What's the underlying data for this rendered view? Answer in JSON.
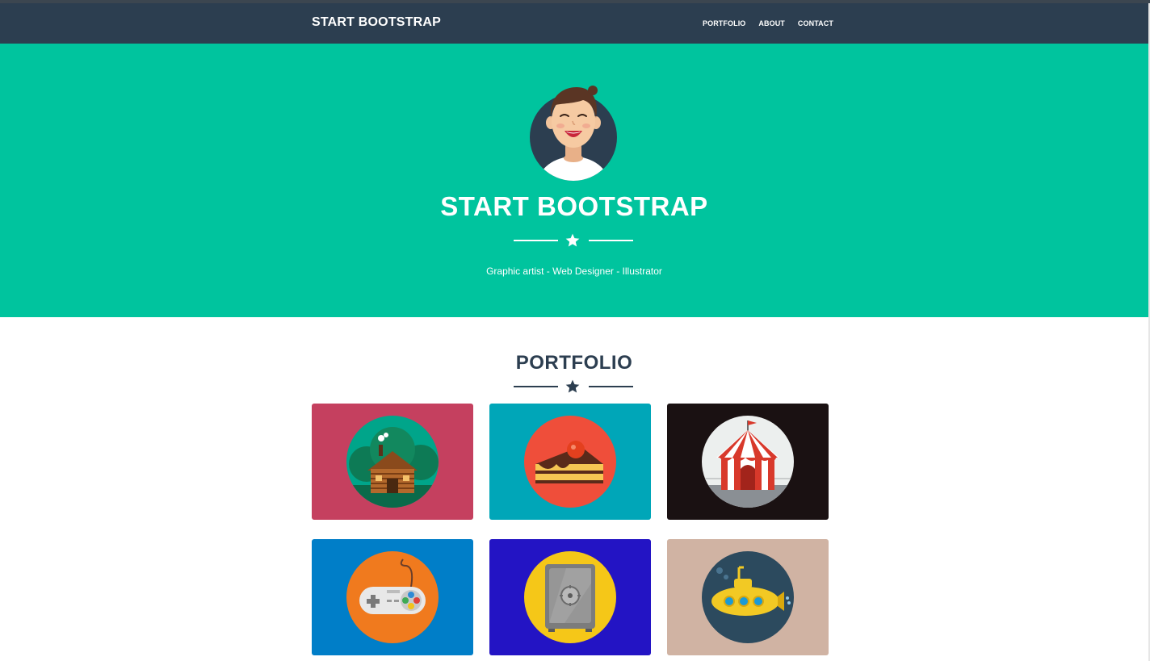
{
  "nav": {
    "brand": "START BOOTSTRAP",
    "links": [
      "PORTFOLIO",
      "ABOUT",
      "CONTACT"
    ]
  },
  "hero": {
    "title": "START BOOTSTRAP",
    "subtitle": "Graphic artist - Web Designer - Illustrator",
    "divider_icon": "star-icon"
  },
  "portfolio": {
    "title": "PORTFOLIO",
    "divider_icon": "star-icon",
    "items": [
      {
        "icon": "cabin-icon",
        "bg": "#c5405f"
      },
      {
        "icon": "cake-icon",
        "bg": "#00a6b8"
      },
      {
        "icon": "circus-tent-icon",
        "bg": "#1a1112"
      },
      {
        "icon": "game-controller-icon",
        "bg": "#007ec8"
      },
      {
        "icon": "safe-icon",
        "bg": "#2314c4"
      },
      {
        "icon": "submarine-icon",
        "bg": "#d0b3a3"
      }
    ]
  },
  "colors": {
    "navbar": "#2c3e50",
    "masthead": "#00c49e",
    "text_dark": "#2c3e50"
  }
}
